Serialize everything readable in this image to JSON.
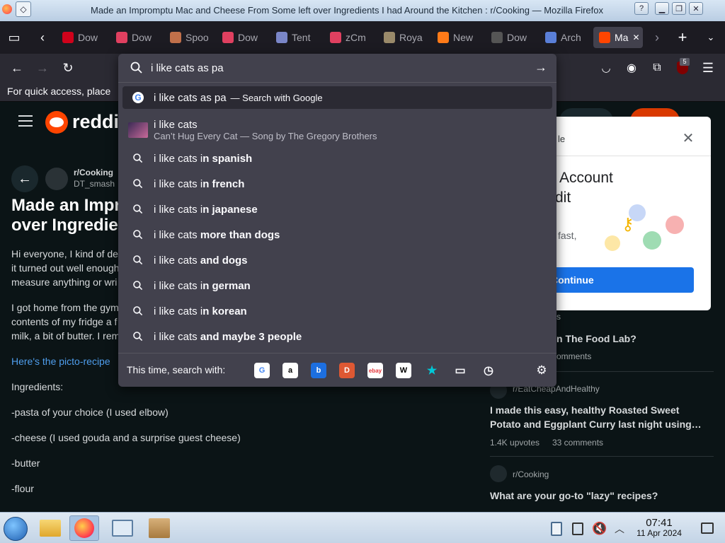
{
  "window": {
    "title": "Made an Impromptu Mac and Cheese From Some left over Ingredients I had Around the Kitchen : r/Cooking — Mozilla Firefox"
  },
  "tabs": [
    {
      "label": "Dow",
      "icon": "reddit-red-icon",
      "color": "#d0021b"
    },
    {
      "label": "Dow",
      "icon": "download-icon",
      "color": "#e04060"
    },
    {
      "label": "Spoo",
      "icon": "pattern-icon",
      "color": "#c0704a"
    },
    {
      "label": "Dow",
      "icon": "download-icon",
      "color": "#e04060"
    },
    {
      "label": "Tent",
      "icon": "flag-icon",
      "color": "#7a86c8"
    },
    {
      "label": "zCm",
      "icon": "download-icon",
      "color": "#e04060"
    },
    {
      "label": "Roya",
      "icon": "game-icon",
      "color": "#9a8a6a"
    },
    {
      "label": "New",
      "icon": "firefox-icon",
      "color": "#ff7a18"
    },
    {
      "label": "Dow",
      "icon": "z7-icon",
      "color": "#555555"
    },
    {
      "label": "Arch",
      "icon": "archive-icon",
      "color": "#5a7fd8"
    },
    {
      "label": "Ma",
      "icon": "reddit-icon",
      "color": "#ff4500",
      "active": true
    }
  ],
  "bookmarks_bar": {
    "text": "For quick access, place"
  },
  "urlbar": {
    "query": "i like cats as pa",
    "suggestions": [
      {
        "type": "google",
        "pre": "i like cats as pa",
        "bold": "",
        "suffix": "— Search with Google"
      },
      {
        "type": "history",
        "title": "i like cats",
        "subtitle": "Can’t Hug Every Cat — Song by The Gregory Brothers"
      },
      {
        "type": "search",
        "pre": "i like cats i",
        "bold": "n spanish"
      },
      {
        "type": "search",
        "pre": "i like cats i",
        "bold": "n french"
      },
      {
        "type": "search",
        "pre": "i like cats i",
        "bold": "n japanese"
      },
      {
        "type": "search",
        "pre": "i like cats ",
        "bold": "more than dogs"
      },
      {
        "type": "search",
        "pre": "i like cats ",
        "bold": "and dogs"
      },
      {
        "type": "search",
        "pre": "i like cats i",
        "bold": "n german"
      },
      {
        "type": "search",
        "pre": "i like cats i",
        "bold": "n korean"
      },
      {
        "type": "search",
        "pre": "i like cats ",
        "bold": "and maybe 3 people"
      }
    ],
    "search_with_label": "This time, search with:",
    "engines": [
      {
        "name": "google",
        "glyph": "G",
        "color": "#4285f4",
        "bg": "#ffffff"
      },
      {
        "name": "amazon",
        "glyph": "a",
        "color": "#000000",
        "bg": "#ffffff"
      },
      {
        "name": "bing",
        "glyph": "b",
        "color": "#ffffff",
        "bg": "#1d6fe0"
      },
      {
        "name": "duckduckgo",
        "glyph": "D",
        "color": "#ffffff",
        "bg": "#de5833"
      },
      {
        "name": "ebay",
        "glyph": "ebay",
        "color": "#e53238",
        "bg": "#ffffff"
      },
      {
        "name": "wikipedia",
        "glyph": "W",
        "color": "#000000",
        "bg": "#ffffff"
      },
      {
        "name": "bookmarks",
        "glyph": "★",
        "color": "#00c8d7",
        "bg": "transparent"
      },
      {
        "name": "tabs",
        "glyph": "▭",
        "color": "#fbfbfe",
        "bg": "transparent"
      },
      {
        "name": "history",
        "glyph": "◷",
        "color": "#fbfbfe",
        "bg": "transparent"
      }
    ]
  },
  "toolbar": {
    "extension_badge": "5"
  },
  "reddit": {
    "logo_text": "reddi",
    "subreddit": "r/Cooking",
    "author": "DT_smash",
    "post_title_1": "Made an Impr",
    "post_title_2": "over Ingredie",
    "body": [
      "Hi everyone, I kind of de",
      "it turned out well enough",
      "measure anything or wri",
      "I got home from the gym",
      "contents of my fridge a f",
      "milk, a bit of butter. I rem"
    ],
    "recipe_link": "Here's the picto-recipe",
    "ingredients_heading": "Ingredients:",
    "ingredients": [
      "-pasta of your choice (I used elbow)",
      "-cheese (I used gouda and a surprise guest cheese)",
      "-butter",
      "-flour"
    ],
    "login_card": {
      "title_fragment": "le",
      "heading_1": "Account",
      "heading_2": "dit",
      "subtext": "fast,",
      "continue_label": "Continue"
    },
    "sidebar": {
      "frag_1": "s",
      "item_0_title": "n The Food Lab?",
      "item_0_meta": "omments",
      "item_1_sub": "r/EatCheapAndHealthy",
      "item_1_title_1": "I made this easy, healthy Roasted Sweet",
      "item_1_title_2": "Potato and Eggplant Curry last night using…",
      "item_1_upvotes": "1.4K upvotes",
      "item_1_comments": "33 comments",
      "item_2_sub": "r/Cooking",
      "item_2_title": "What are your go-to \"lazy\" recipes?"
    }
  },
  "taskbar": {
    "time": "07:41",
    "date": "11 Apr 2024"
  }
}
